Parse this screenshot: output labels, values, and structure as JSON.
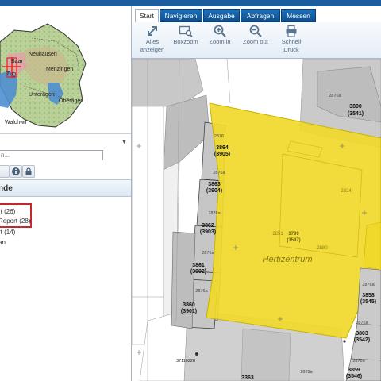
{
  "overview_map": {
    "labels": [
      "Neuhausen",
      "Menzingen",
      "Unterägeri",
      "Oberägeri",
      "Walchwil"
    ],
    "short_labels": [
      "Baar",
      "Zug"
    ]
  },
  "sidebar": {
    "search_placeholder": "n...",
    "legend_title": "nde",
    "items": [
      {
        "label": "rt (26)"
      },
      {
        "label": "Report (28)"
      },
      {
        "label": "rt (14)"
      },
      {
        "label": "an"
      }
    ]
  },
  "ribbon": {
    "tabs": [
      "Start",
      "Navigieren",
      "Ausgabe",
      "Abfragen",
      "Messen"
    ],
    "active_tab": "Start",
    "buttons": [
      {
        "label_line1": "Alles",
        "label_line2": "anzeigen",
        "icon": "expand-arrow-icon"
      },
      {
        "label_line1": "Boxzoom",
        "label_line2": "",
        "icon": "box-zoom-icon"
      },
      {
        "label_line1": "Zoom in",
        "label_line2": "",
        "icon": "zoom-in-icon"
      },
      {
        "label_line1": "Zoom out",
        "label_line2": "",
        "icon": "zoom-out-icon"
      },
      {
        "label_line1": "Schnell",
        "label_line2": "Druck",
        "icon": "printer-icon"
      }
    ]
  },
  "map": {
    "highlight_color": "#f0d92a",
    "building_name": "Hertizentrum",
    "parcels": [
      {
        "number": "3800",
        "id": "(3541)"
      },
      {
        "number": "3864",
        "id": "(3905)"
      },
      {
        "number": "3863",
        "id": "(3904)"
      },
      {
        "number": "3862",
        "id": "(3903)"
      },
      {
        "number": "3861",
        "id": "(3902)"
      },
      {
        "number": "3860",
        "id": "(3901)"
      },
      {
        "number": "3799",
        "id": "(3547)"
      },
      {
        "number": "3858",
        "id": "(3545)"
      },
      {
        "number": "3803",
        "id": "(3542)"
      },
      {
        "number": "3859",
        "id": "(3546)"
      },
      {
        "number": "3363",
        "id": ""
      }
    ],
    "small_labels": [
      "2876a",
      "2876",
      "2876a",
      "2876a",
      "2876a",
      "2876a",
      "2876a",
      "2876a",
      "2876a",
      "2851",
      "2824",
      "2880",
      "2829a"
    ],
    "point_label": "37110228"
  }
}
